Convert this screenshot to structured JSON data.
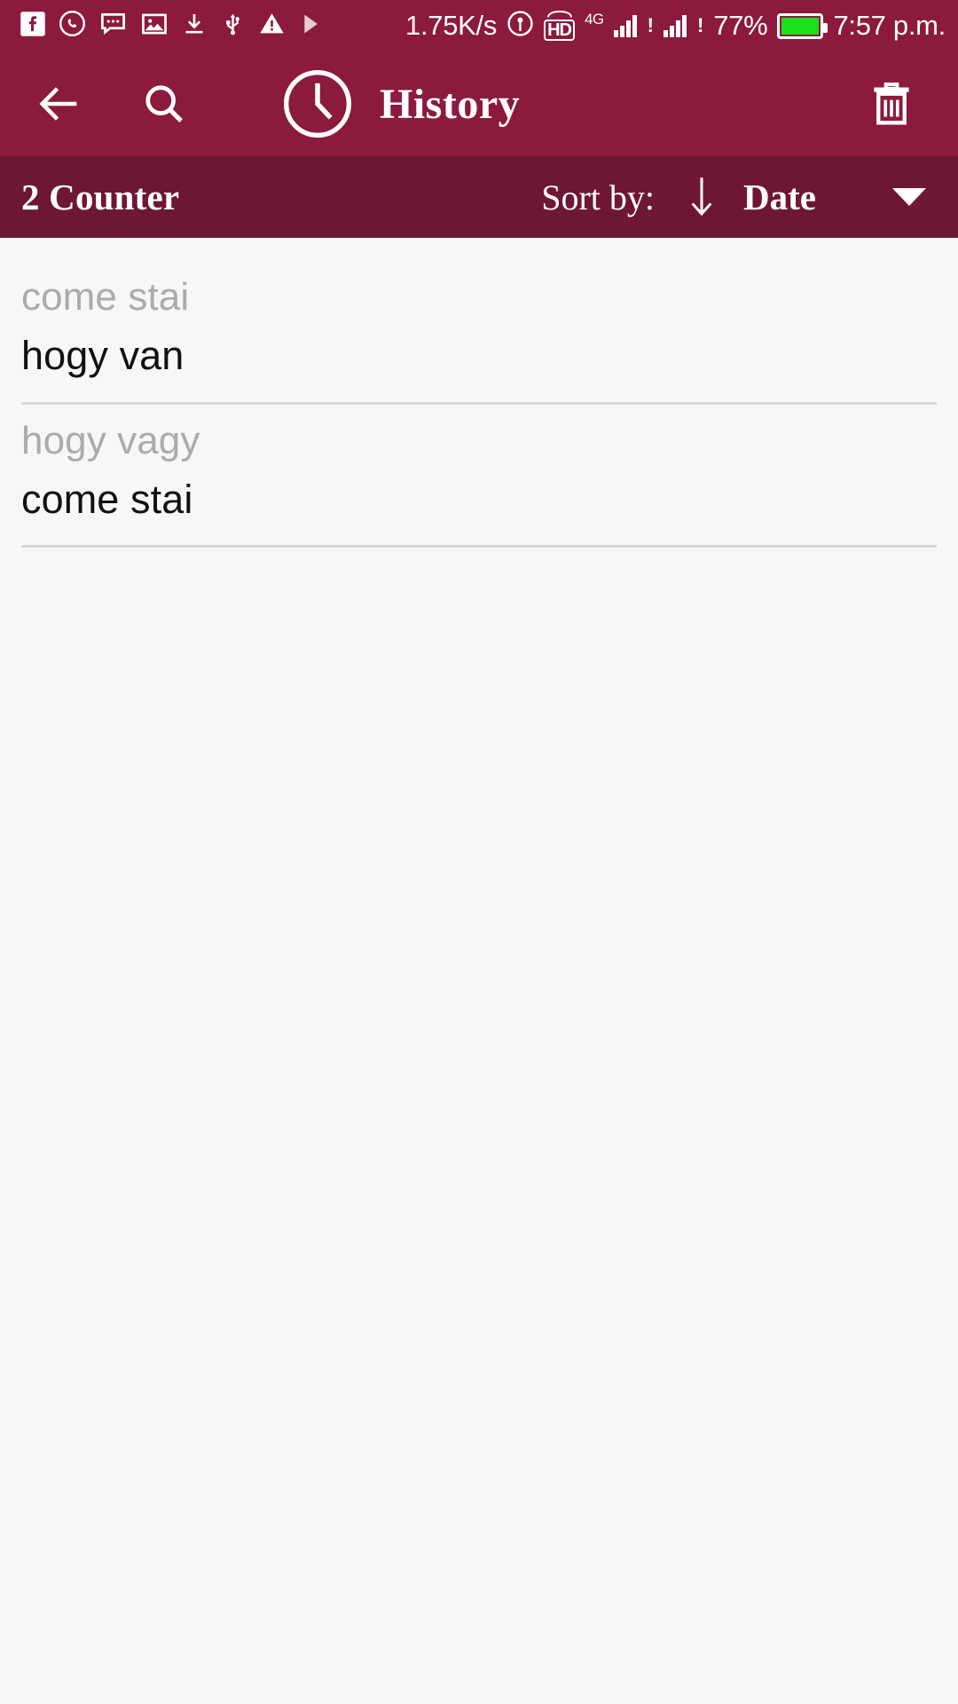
{
  "statusbar": {
    "left_icons": [
      {
        "name": "facebook-icon",
        "label": "Facebook"
      },
      {
        "name": "whatsapp-icon",
        "label": "WhatsApp"
      },
      {
        "name": "message-icon",
        "label": "Messages"
      },
      {
        "name": "image-icon",
        "label": "Gallery"
      },
      {
        "name": "download-icon",
        "label": "Download"
      },
      {
        "name": "usb-icon",
        "label": "USB"
      },
      {
        "name": "warning-icon",
        "label": "Warning"
      },
      {
        "name": "play-icon",
        "label": "Play"
      }
    ],
    "network_speed": "1.75K/s",
    "hotspot_icon": "hotspot-icon",
    "hd_label": "HD",
    "network_type": "4G",
    "signal_bang": "!",
    "battery_percent": "77%",
    "battery_color": "#1BE01B",
    "time": "7:57 p.m."
  },
  "appbar": {
    "back_icon": "back-arrow-icon",
    "search_icon": "search-icon",
    "clock_icon": "clock-icon",
    "title": "History",
    "delete_icon": "trash-icon",
    "background_color": "#8B1A3D"
  },
  "sortbar": {
    "counter": "2 Counter",
    "sort_label": "Sort by:",
    "sort_direction_icon": "arrow-down-icon",
    "sort_value": "Date",
    "dropdown_icon": "caret-down-icon",
    "background_color": "#6E1733"
  },
  "history": {
    "items": [
      {
        "source": "come stai",
        "translation": "hogy van"
      },
      {
        "source": "hogy vagy",
        "translation": "come stai"
      }
    ]
  },
  "colors": {
    "accent": "#8B1A3D",
    "accent_dark": "#6E1733",
    "content_background": "#F7F7F7",
    "source_text": "#ABABAB",
    "translation_text": "#111111",
    "divider": "#D8D8D8"
  }
}
